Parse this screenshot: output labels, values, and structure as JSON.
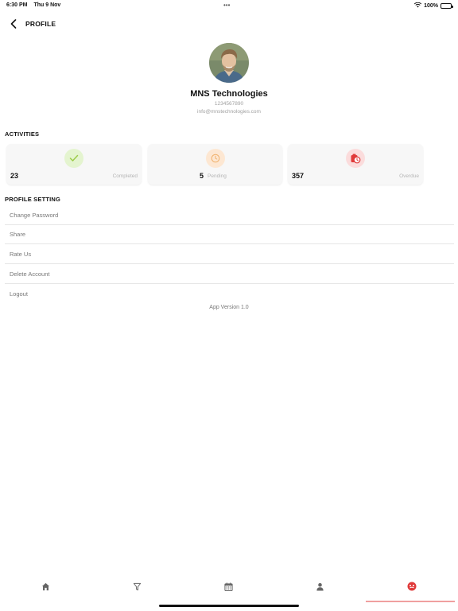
{
  "status_bar": {
    "time": "6:30 PM",
    "date": "Thu 9 Nov",
    "dots": "•••",
    "battery": "100%"
  },
  "header": {
    "title": "PROFILE"
  },
  "profile": {
    "name": "MNS Technologies",
    "phone": "1234567890",
    "email": "info@mnstechnologies.com"
  },
  "activities": {
    "title": "ACTIVITIES",
    "cards": [
      {
        "count": "23",
        "label": "Completed",
        "icon": "check-icon",
        "color": "#9ccc4a",
        "bg": "#e4f4cf"
      },
      {
        "count": "5",
        "label": "Pending",
        "icon": "clock-icon",
        "color": "#f0b06a",
        "bg": "#fde7d2"
      },
      {
        "count": "357",
        "label": "Overdue",
        "icon": "overdue-clock-icon",
        "color": "#e03a3a",
        "bg": "#fbdcdc"
      }
    ]
  },
  "settings": {
    "title": "PROFILE SETTING",
    "items": [
      "Change Password",
      "Share",
      "Rate Us",
      "Delete Account",
      "Logout"
    ]
  },
  "app_version": "App Version 1.0",
  "tabbar": {
    "tabs": [
      "home-icon",
      "filter-icon",
      "calendar-icon",
      "user-icon",
      "profile-face-icon"
    ],
    "active_color": "#e03a3a",
    "inactive_color": "#666666"
  }
}
